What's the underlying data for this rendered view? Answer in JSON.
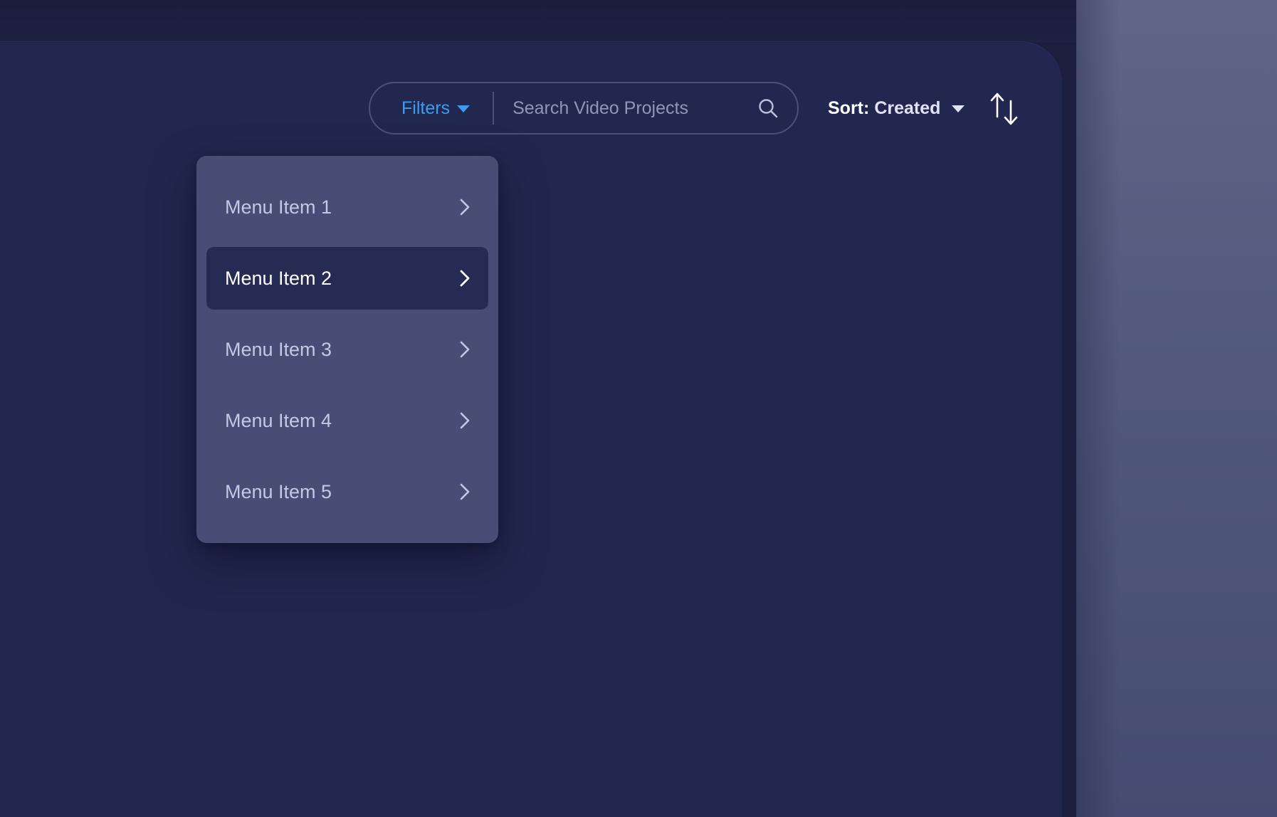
{
  "toolbar": {
    "filters_label": "Filters",
    "search_placeholder": "Search Video Projects",
    "sort_prefix": "Sort:",
    "sort_value": "Created"
  },
  "menu": {
    "items": [
      {
        "label": "Menu Item 1"
      },
      {
        "label": "Menu Item 2",
        "active": true
      },
      {
        "label": "Menu Item 3"
      },
      {
        "label": "Menu Item 4"
      },
      {
        "label": "Menu Item 5"
      }
    ]
  },
  "icons": {
    "filters_caret": "caret-down-icon",
    "search": "search-icon",
    "sort_caret": "caret-down-icon",
    "sort_order": "sort-order-icon",
    "menu_chevron": "chevron-right-icon"
  },
  "colors": {
    "accent": "#3b9cf0",
    "card_bg": "#222750",
    "menu_bg": "#484d75",
    "menu_active_bg": "#262b53"
  }
}
